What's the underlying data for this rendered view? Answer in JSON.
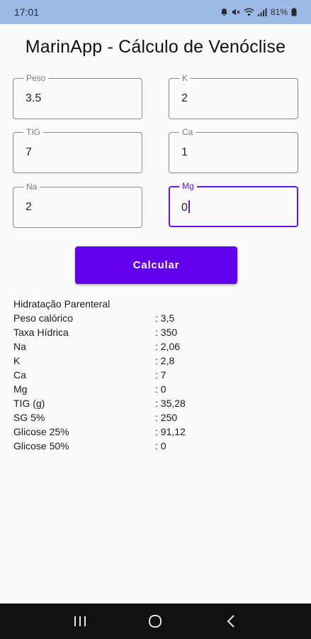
{
  "status_bar": {
    "time": "17:01",
    "battery": "81%",
    "icons": [
      "notification-icon",
      "mute-icon",
      "wifi-icon",
      "signal-icon",
      "battery-icon"
    ]
  },
  "app": {
    "title": "MarinApp - Cálculo de Venóclise",
    "accent_color": "#6200ee"
  },
  "form": {
    "peso": {
      "label": "Peso",
      "value": "3.5"
    },
    "k": {
      "label": "K",
      "value": "2"
    },
    "tig": {
      "label": "TIG",
      "value": "7"
    },
    "ca": {
      "label": "Ca",
      "value": "1"
    },
    "na": {
      "label": "Na",
      "value": "2"
    },
    "mg": {
      "label": "Mg",
      "value": "0"
    }
  },
  "calculate_button": {
    "label": "Calcular"
  },
  "results": {
    "heading": "Hidratação Parenteral",
    "rows": [
      {
        "label": "Peso calórico",
        "value": ": 3,5"
      },
      {
        "label": "Taxa Hídrica",
        "value": ": 350"
      },
      {
        "label": "Na",
        "value": ": 2,06"
      },
      {
        "label": "K",
        "value": ": 2,8"
      },
      {
        "label": "Ca",
        "value": ": 7"
      },
      {
        "label": "Mg",
        "value": ": 0"
      },
      {
        "label": "TIG (g)",
        "value": ": 35,28"
      },
      {
        "label": "SG 5%",
        "value": ": 250"
      },
      {
        "label": "Glicose 25%",
        "value": ": 91,12"
      },
      {
        "label": "Glicose 50%",
        "value": ": 0"
      }
    ]
  },
  "nav_bar": {
    "buttons": [
      "recent-apps-icon",
      "home-icon",
      "back-icon"
    ]
  }
}
